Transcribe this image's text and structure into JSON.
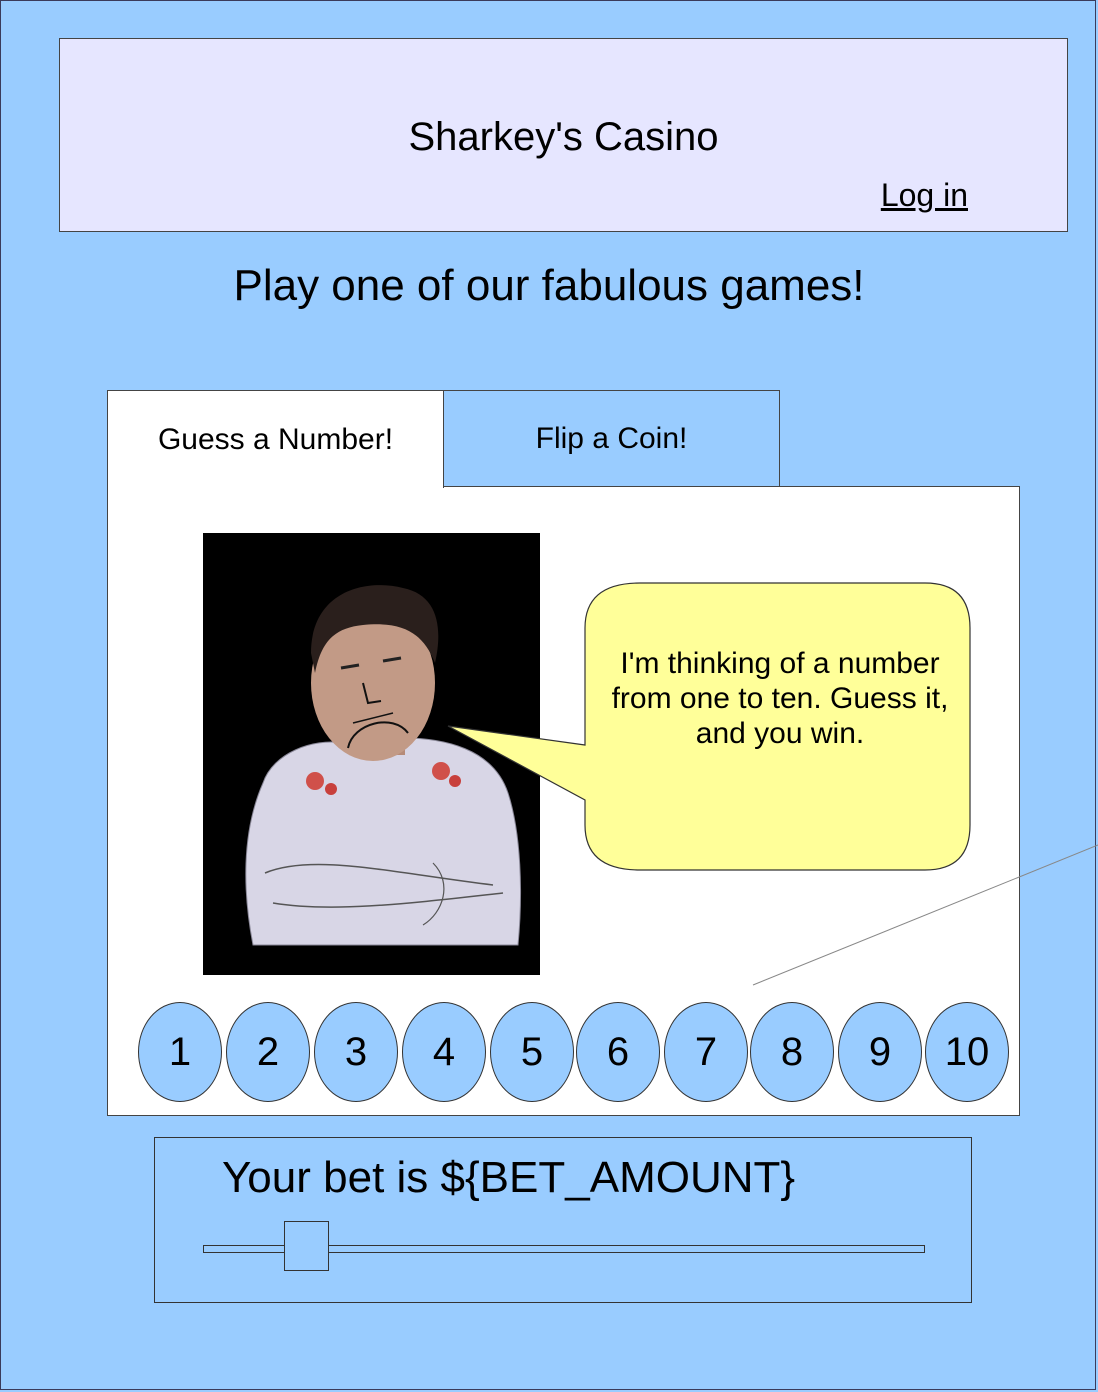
{
  "header": {
    "title": "Sharkey's Casino",
    "login_label": "Log in"
  },
  "tagline": "Play one of our fabulous games!",
  "tabs": [
    {
      "label": "Guess a Number!",
      "active": true
    },
    {
      "label": "Flip a Coin!",
      "active": false
    }
  ],
  "dealer": {
    "speech": "I'm thinking of a number from one to ten. Guess it, and you win."
  },
  "number_buttons": [
    "1",
    "2",
    "3",
    "4",
    "5",
    "6",
    "7",
    "8",
    "9",
    "10"
  ],
  "bet": {
    "label": "Your bet is ${BET_AMOUNT}",
    "slider_fraction": 0.12
  },
  "colors": {
    "background": "#99ccff",
    "header": "#e6e6ff",
    "bubble": "#ffff99"
  }
}
